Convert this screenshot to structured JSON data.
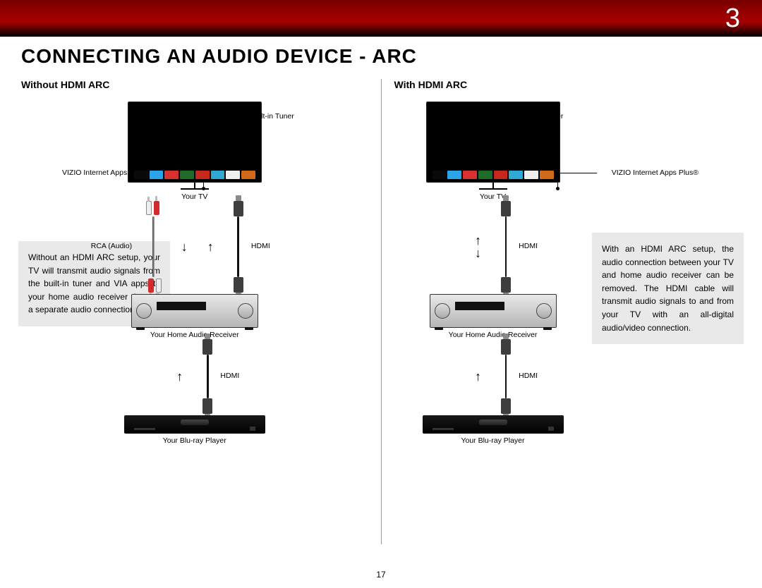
{
  "page": {
    "chapter": "3",
    "number": "17",
    "title": "CONNECTING AN AUDIO DEVICE - ARC"
  },
  "left": {
    "heading": "Without HDMI ARC",
    "callout_tuner": "Built-in Tuner",
    "callout_apps": "VIZIO Internet Apps Plus®",
    "tv_label": "Your TV",
    "receiver_label": "Your Home Audio Receiver",
    "bluray_label": "Your Blu-ray Player",
    "cable_rca": "RCA (Audio)",
    "cable_hdmi1": "HDMI",
    "cable_hdmi2": "HDMI",
    "info": "Without an HDMI ARC setup, your TV will transmit audio signals from the built-in tuner and VIA apps to your home audio receiver through a separate audio connection."
  },
  "right": {
    "heading": "With HDMI ARC",
    "callout_tuner": "Built-in Tuner",
    "callout_apps": "VIZIO Internet Apps Plus®",
    "tv_label": "Your TV",
    "receiver_label": "Your Home Audio Receiver",
    "bluray_label": "Your Blu-ray Player",
    "cable_hdmi1": "HDMI",
    "cable_hdmi2": "HDMI",
    "info": "With an HDMI ARC setup, the audio connection between your TV and home audio receiver can be removed. The HDMI cable will transmit audio signals to and from your TV with an all-digital audio/video connection."
  }
}
